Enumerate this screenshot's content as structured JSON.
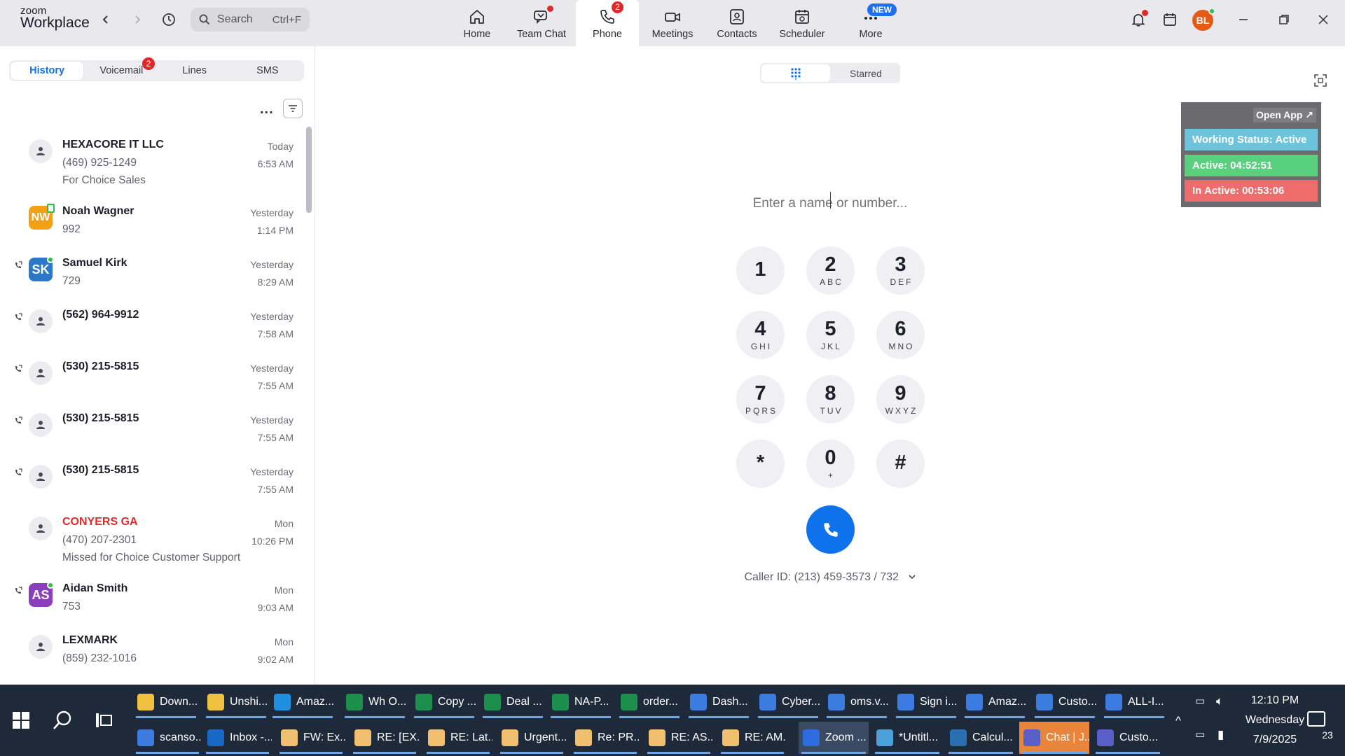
{
  "app": {
    "logo_top": "zoom",
    "logo_bottom": "Workplace",
    "search_placeholder": "Search",
    "search_shortcut": "Ctrl+F",
    "nav": [
      {
        "label": "Home"
      },
      {
        "label": "Team Chat"
      },
      {
        "label": "Phone",
        "badge": "2"
      },
      {
        "label": "Meetings"
      },
      {
        "label": "Contacts"
      },
      {
        "label": "Scheduler"
      },
      {
        "label": "More",
        "badge": "NEW"
      }
    ],
    "user_initials": "BL"
  },
  "left": {
    "tabs": [
      "History",
      "Voicemail",
      "Lines",
      "SMS"
    ],
    "voicemail_badge": "2",
    "more": "...",
    "history": [
      {
        "name": "HEXACORE IT LLC",
        "sub": "(469) 925-1249",
        "sub2": "For Choice Sales",
        "day": "Today",
        "time": "6:53 AM"
      },
      {
        "name": "Noah Wagner",
        "initials": "NW",
        "sub": "992",
        "day": "Yesterday",
        "time": "1:14 PM"
      },
      {
        "name": "Samuel Kirk",
        "initials": "SK",
        "sub": "729",
        "day": "Yesterday",
        "time": "8:29 AM"
      },
      {
        "name": "(562) 964-9912",
        "day": "Yesterday",
        "time": "7:58 AM"
      },
      {
        "name": "(530) 215-5815",
        "day": "Yesterday",
        "time": "7:55 AM"
      },
      {
        "name": "(530) 215-5815",
        "day": "Yesterday",
        "time": "7:55 AM"
      },
      {
        "name": "(530) 215-5815",
        "day": "Yesterday",
        "time": "7:55 AM"
      },
      {
        "name": "CONYERS GA",
        "sub": "(470) 207-2301",
        "sub2": "Missed for Choice Customer Support",
        "day": "Mon",
        "time": "10:26 PM"
      },
      {
        "name": "Aidan Smith",
        "initials": "AS",
        "sub": "753",
        "day": "Mon",
        "time": "9:03 AM"
      },
      {
        "name": "LEXMARK",
        "sub": "(859) 232-1016",
        "day": "Mon",
        "time": "9:02 AM"
      }
    ]
  },
  "dialer": {
    "toggle_starred": "Starred",
    "input_placeholder": "Enter a name or number...",
    "keys": [
      {
        "d": "1",
        "l": ""
      },
      {
        "d": "2",
        "l": "ABC"
      },
      {
        "d": "3",
        "l": "DEF"
      },
      {
        "d": "4",
        "l": "GHI"
      },
      {
        "d": "5",
        "l": "JKL"
      },
      {
        "d": "6",
        "l": "MNO"
      },
      {
        "d": "7",
        "l": "PQRS"
      },
      {
        "d": "8",
        "l": "TUV"
      },
      {
        "d": "9",
        "l": "WXYZ"
      },
      {
        "d": "*",
        "l": ""
      },
      {
        "d": "0",
        "l": "+"
      },
      {
        "d": "#",
        "l": ""
      }
    ],
    "caller_id": "Caller ID: (213) 459-3573 / 732"
  },
  "status_widget": {
    "open_app": "Open App",
    "working": "Working Status: Active",
    "active": "Active: 04:52:51",
    "inactive": "In Active: 00:53:06"
  },
  "taskbar": {
    "row1": [
      "Down...",
      "Unshi...",
      "Amaz...",
      "Wh O...",
      "Copy ...",
      "Deal ...",
      "NA-P...",
      "order...",
      "Dash...",
      "Cyber...",
      "oms.v...",
      "Sign i...",
      "Amaz...",
      "Custo...",
      "ALL-I..."
    ],
    "row2": [
      "scanso...",
      "Inbox -...",
      "FW: Ex...",
      "RE: [EX...",
      "RE: Lat...",
      "Urgent...",
      "Re: PR...",
      "RE: AS...",
      "RE: AM...",
      "Zoom ...",
      "*Untitl...",
      "Calcul...",
      "Chat | J...",
      "Custo..."
    ],
    "time": "12:10 PM",
    "day": "Wednesday",
    "date": "7/9/2025",
    "notif_count": "23"
  },
  "colors": {
    "accent": "#0e72ed",
    "missed": "#de2a2a",
    "ws_working": "#6dc3d9",
    "ws_active": "#58d07d",
    "ws_inactive": "#ef6c6c"
  }
}
